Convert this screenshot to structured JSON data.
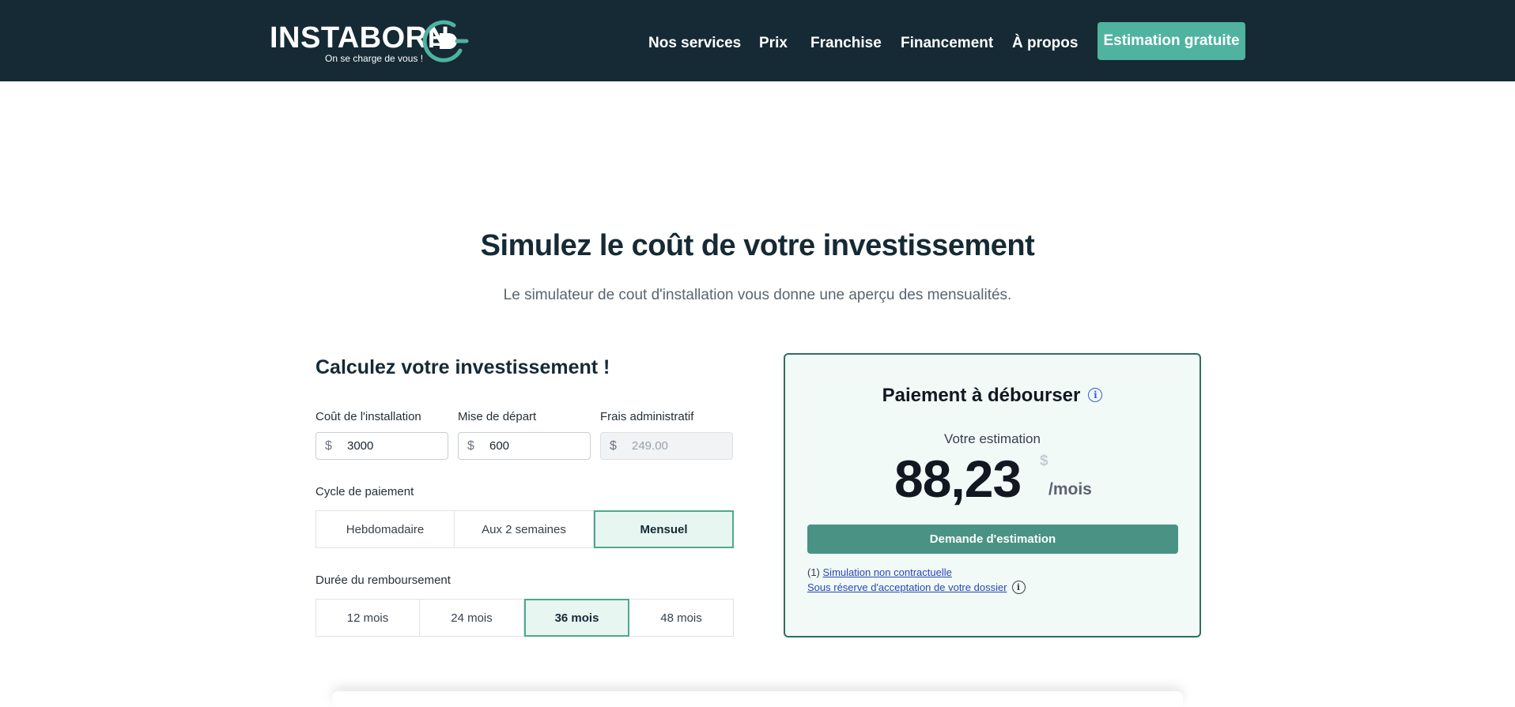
{
  "header": {
    "logo": {
      "wordmark": "INSTABORN",
      "tagline": "On se charge de vous !"
    },
    "nav": [
      {
        "label": "Nos services"
      },
      {
        "label": "Prix"
      },
      {
        "label": "Franchise"
      },
      {
        "label": "Financement"
      },
      {
        "label": "À propos"
      }
    ],
    "cta_label": "Estimation gratuite"
  },
  "hero": {
    "title": "Simulez le coût de votre investissement",
    "subtitle": "Le simulateur de cout d'installation vous donne une aperçu des mensualités."
  },
  "calculator": {
    "title": "Calculez votre investissement !",
    "fields": {
      "install_cost": {
        "label": "Coût de l'installation",
        "currency": "$",
        "value": "3000"
      },
      "down_payment": {
        "label": "Mise de départ",
        "currency": "$",
        "value": "600"
      },
      "admin_fee": {
        "label": "Frais administratif",
        "currency": "$",
        "value": "249.00",
        "disabled": true
      }
    },
    "payment_cycle": {
      "label": "Cycle de paiement",
      "options": [
        "Hebdomadaire",
        "Aux 2 semaines",
        "Mensuel"
      ],
      "selected": "Mensuel"
    },
    "duration": {
      "label": "Durée du remboursement",
      "options": [
        "12 mois",
        "24 mois",
        "36 mois",
        "48 mois"
      ],
      "selected": "36 mois"
    }
  },
  "result": {
    "title": "Paiement à débourser",
    "estimate_label": "Votre estimation",
    "amount": "88,23",
    "currency": "$",
    "unit": "/mois",
    "button_label": "Demande d'estimation",
    "note_prefix": "(1)",
    "note_link": "Simulation non contractuelle",
    "note2_link": "Sous réserve d'acceptation de votre dossier"
  },
  "colors": {
    "header_bg": "#152a35",
    "accent": "#4fb3a0",
    "card_border": "#2f6e60",
    "card_bg": "#f1faf7",
    "primary_button": "#4a9384",
    "link": "#2846b8"
  }
}
